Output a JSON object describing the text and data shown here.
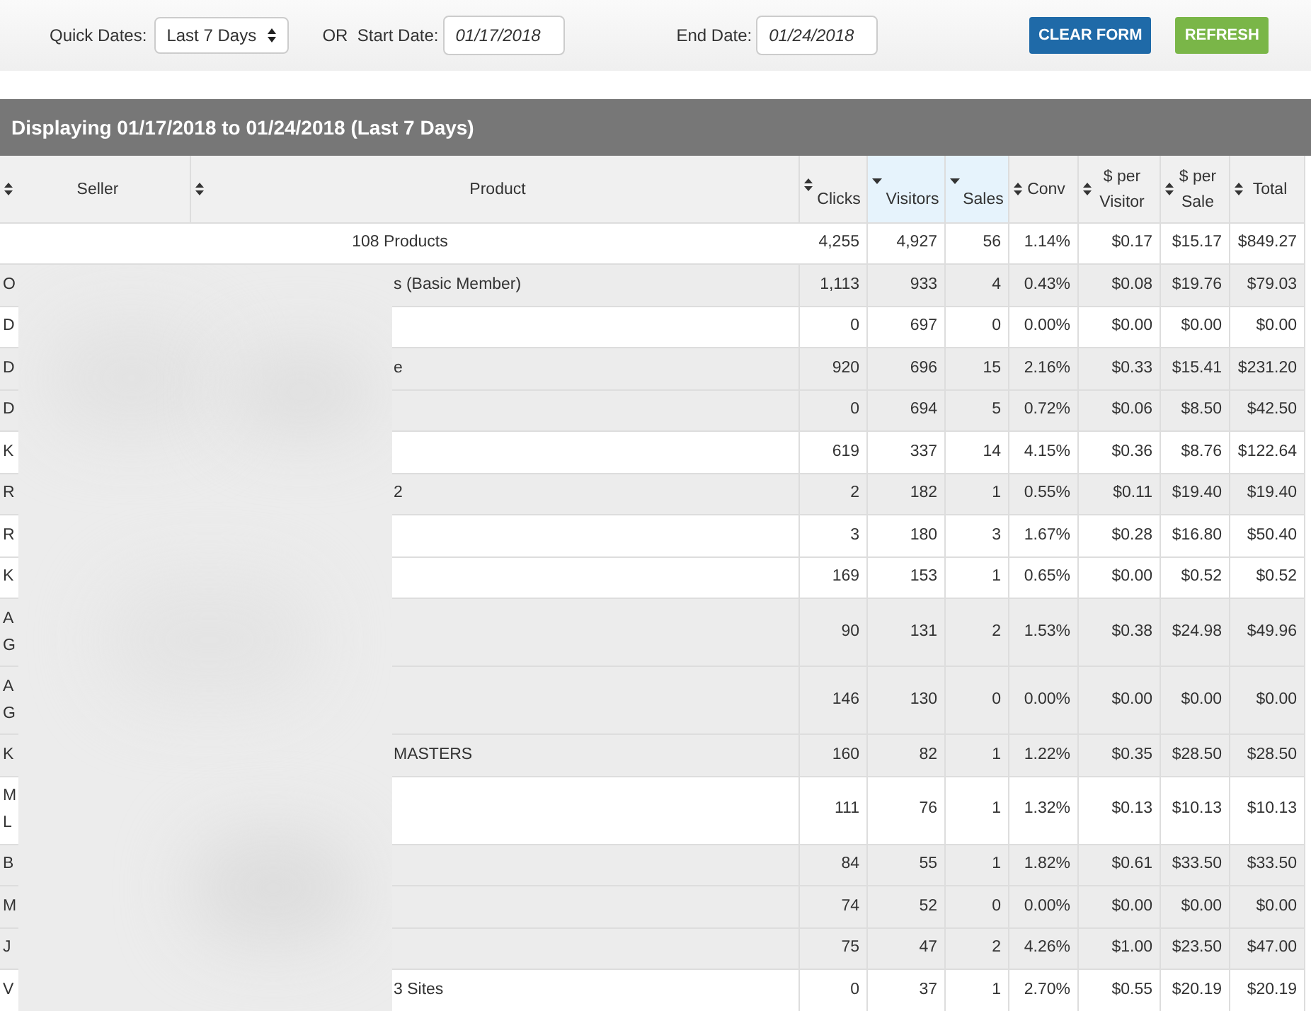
{
  "filters": {
    "quick_dates_label": "Quick Dates:",
    "quick_dates_value": "Last 7 Days",
    "start_label": "OR  Start Date:",
    "start_value": "01/17/2018",
    "end_label": "End Date:",
    "end_value": "01/24/2018",
    "buttons": [
      {
        "label": "CLEAR FORM",
        "kind": "primary"
      },
      {
        "label": "REFRESH",
        "kind": "success"
      }
    ]
  },
  "title": "Displaying 01/17/2018 to 01/24/2018 (Last 7 Days)",
  "table": {
    "columns": [
      {
        "label": "Seller",
        "sorted": false,
        "kind": "inline"
      },
      {
        "label": "Product",
        "sorted": false,
        "kind": "inline"
      },
      {
        "label": "Clicks",
        "sorted": false,
        "kind": "stacked"
      },
      {
        "label": "Visitors",
        "sorted": true,
        "kind": "stacked"
      },
      {
        "label": "Sales",
        "sorted": true,
        "kind": "stacked"
      },
      {
        "label": "Conv",
        "sorted": false,
        "kind": "inline"
      },
      {
        "label": "$ per Visitor",
        "sorted": false,
        "kind": "inline"
      },
      {
        "label": "$ per Sale",
        "sorted": false,
        "kind": "inline"
      },
      {
        "label": "Total",
        "sorted": false,
        "kind": "inline"
      }
    ],
    "summary": {
      "label": "108 Products",
      "values": [
        "4,255",
        "4,927",
        "56",
        "1.14%",
        "$0.17",
        "$15.17",
        "$849.27"
      ]
    },
    "rows": [
      {
        "seller": [
          "O"
        ],
        "product": "s (Basic Member)",
        "shaded": true,
        "values": [
          "1,113",
          "933",
          "4",
          "0.43%",
          "$0.08",
          "$19.76",
          "$79.03"
        ]
      },
      {
        "seller": [
          "D"
        ],
        "shaded": false,
        "values": [
          "0",
          "697",
          "0",
          "0.00%",
          "$0.00",
          "$0.00",
          "$0.00"
        ]
      },
      {
        "seller": [
          "D"
        ],
        "product": "e",
        "shaded": true,
        "values": [
          "920",
          "696",
          "15",
          "2.16%",
          "$0.33",
          "$15.41",
          "$231.20"
        ]
      },
      {
        "seller": [
          "D"
        ],
        "shaded": true,
        "values": [
          "0",
          "694",
          "5",
          "0.72%",
          "$0.06",
          "$8.50",
          "$42.50"
        ]
      },
      {
        "seller": [
          "K"
        ],
        "shaded": false,
        "values": [
          "619",
          "337",
          "14",
          "4.15%",
          "$0.36",
          "$8.76",
          "$122.64"
        ]
      },
      {
        "seller": [
          "R"
        ],
        "product": "2",
        "shaded": true,
        "values": [
          "2",
          "182",
          "1",
          "0.55%",
          "$0.11",
          "$19.40",
          "$19.40"
        ]
      },
      {
        "seller": [
          "R"
        ],
        "shaded": false,
        "values": [
          "3",
          "180",
          "3",
          "1.67%",
          "$0.28",
          "$16.80",
          "$50.40"
        ]
      },
      {
        "seller": [
          "K"
        ],
        "shaded": false,
        "values": [
          "169",
          "153",
          "1",
          "0.65%",
          "$0.00",
          "$0.52",
          "$0.52"
        ]
      },
      {
        "seller": [
          "A",
          "G"
        ],
        "shaded": true,
        "values": [
          "90",
          "131",
          "2",
          "1.53%",
          "$0.38",
          "$24.98",
          "$49.96"
        ]
      },
      {
        "seller": [
          "A",
          "G"
        ],
        "shaded": true,
        "values": [
          "146",
          "130",
          "0",
          "0.00%",
          "$0.00",
          "$0.00",
          "$0.00"
        ]
      },
      {
        "seller": [
          "K"
        ],
        "product": "MASTERS",
        "shaded": true,
        "values": [
          "160",
          "82",
          "1",
          "1.22%",
          "$0.35",
          "$28.50",
          "$28.50"
        ]
      },
      {
        "seller": [
          "M",
          "L"
        ],
        "shaded": false,
        "values": [
          "111",
          "76",
          "1",
          "1.32%",
          "$0.13",
          "$10.13",
          "$10.13"
        ]
      },
      {
        "seller": [
          "B"
        ],
        "shaded": true,
        "values": [
          "84",
          "55",
          "1",
          "1.82%",
          "$0.61",
          "$33.50",
          "$33.50"
        ]
      },
      {
        "seller": [
          "M"
        ],
        "shaded": true,
        "values": [
          "74",
          "52",
          "0",
          "0.00%",
          "$0.00",
          "$0.00",
          "$0.00"
        ]
      },
      {
        "seller": [
          "J"
        ],
        "shaded": true,
        "values": [
          "75",
          "47",
          "2",
          "4.26%",
          "$1.00",
          "$23.50",
          "$47.00"
        ]
      },
      {
        "seller": [
          "V"
        ],
        "product": "3 Sites",
        "shaded": false,
        "values": [
          "0",
          "37",
          "1",
          "2.70%",
          "$0.55",
          "$20.19",
          "$20.19"
        ]
      }
    ]
  }
}
